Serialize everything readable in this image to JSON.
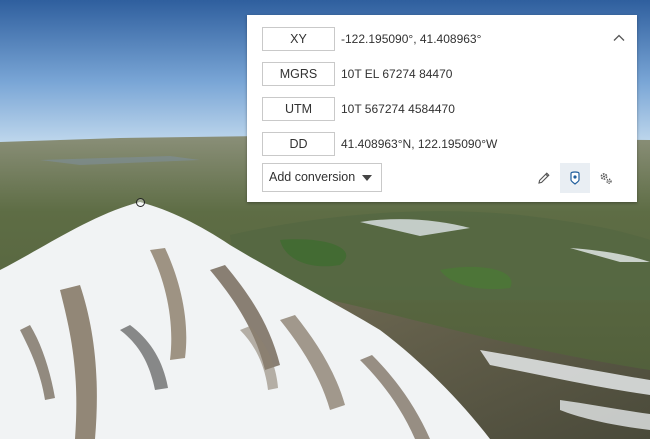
{
  "coordinate_panel": {
    "rows": [
      {
        "format": "XY",
        "value": "-122.195090°, 41.408963°"
      },
      {
        "format": "MGRS",
        "value": "10T EL 67274 84470"
      },
      {
        "format": "UTM",
        "value": "10T 567274 4584470"
      },
      {
        "format": "DD",
        "value": "41.408963°N, 122.195090°W"
      }
    ],
    "add_conversion_label": "Add conversion",
    "icons": {
      "collapse": "chevron-up-icon",
      "edit": "pencil-icon",
      "capture": "map-pin-icon",
      "settings": "gears-icon"
    }
  },
  "colors": {
    "panel_bg": "#ffffff",
    "border": "#c9c9c9",
    "text": "#323232",
    "active_tool_bg": "#e9eef3"
  }
}
